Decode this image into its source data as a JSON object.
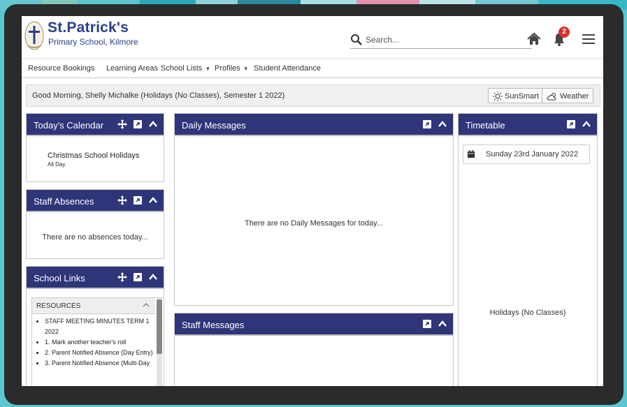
{
  "school": {
    "name": "St.Patrick's",
    "subtitle": "Primary School, Kilmore"
  },
  "search": {
    "placeholder": "Search..."
  },
  "notifications": {
    "count": "2"
  },
  "nav": {
    "items": [
      "Resource Bookings",
      "Learning Areas",
      "School Lists",
      "Profiles",
      "Student Attendance"
    ]
  },
  "greeting": {
    "text": "Good Morning, Shelly Michalke (Holidays (No Classes), Semester 1 2022)",
    "sunsmart_label": "SunSmart",
    "weather_label": "Weather"
  },
  "calendar": {
    "title": "Today's Calendar",
    "event": "Christmas School Holidays",
    "event_time": "All Day"
  },
  "absences": {
    "title": "Staff Absences",
    "empty": "There are no absences today..."
  },
  "links": {
    "title": "School Links",
    "section": "RESOURCES",
    "items": [
      "STAFF MEETING MINUTES TERM 1 2022",
      "1. Mark another teacher's roll",
      "2. Parent Notified Absence (Day Entry)",
      "3. Parent Notified Absence (Multi-Day"
    ]
  },
  "daily": {
    "title": "Daily Messages",
    "empty": "There are no Daily Messages for today..."
  },
  "staff_messages": {
    "title": "Staff Messages"
  },
  "timetable": {
    "title": "Timetable",
    "date": "Sunday 23rd January 2022",
    "status": "Holidays (No Classes)"
  },
  "colors": {
    "panel_header": "#2e3579",
    "brand": "#2a3f8f",
    "badge": "#d9312e"
  }
}
